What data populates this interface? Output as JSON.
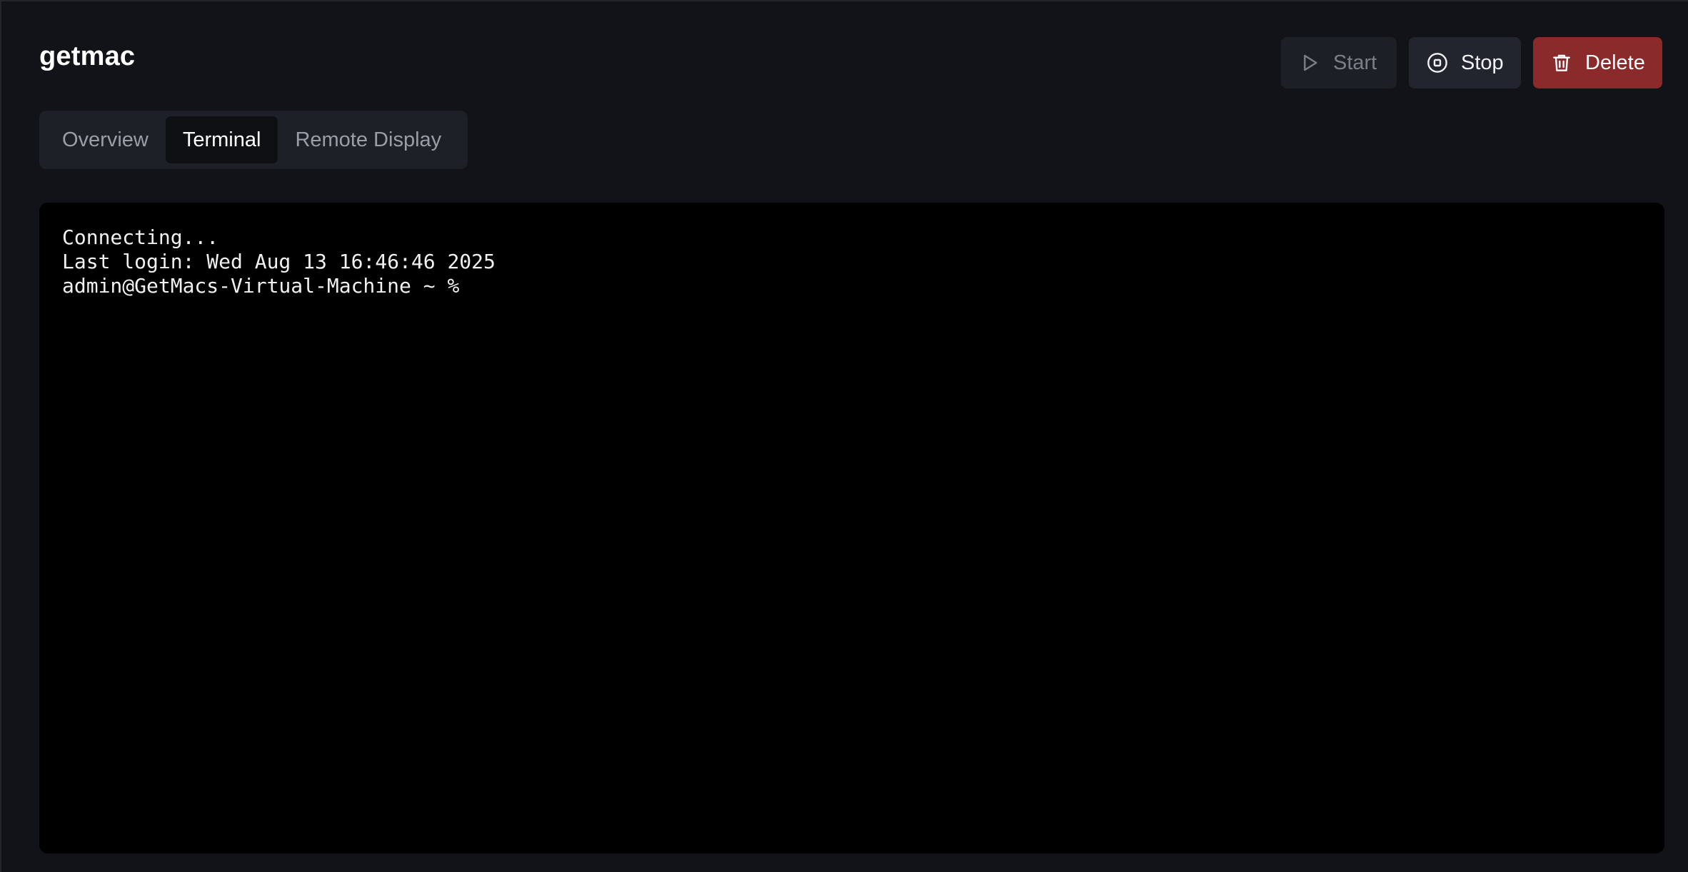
{
  "page": {
    "title": "getmac"
  },
  "toolbar": {
    "start_label": "Start",
    "stop_label": "Stop",
    "delete_label": "Delete",
    "start_icon": "play-icon",
    "stop_icon": "stop-circle-icon",
    "delete_icon": "trash-icon"
  },
  "tabs": [
    {
      "label": "Overview",
      "active": false
    },
    {
      "label": "Terminal",
      "active": true
    },
    {
      "label": "Remote Display",
      "active": false
    }
  ],
  "terminal": {
    "lines": [
      "Connecting...",
      "Last login: Wed Aug 13 16:46:46 2025",
      "admin@GetMacs-Virtual-Machine ~ % "
    ]
  },
  "colors": {
    "background": "#121318",
    "delete_accent": "#8b2a2a",
    "terminal_bg": "#000000"
  }
}
